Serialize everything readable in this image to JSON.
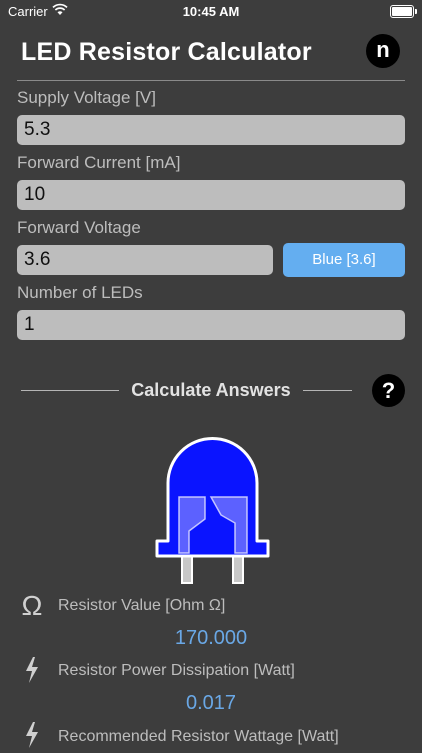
{
  "status_bar": {
    "carrier": "Carrier",
    "time": "10:45 AM"
  },
  "header": {
    "title": "LED Resistor Calculator",
    "info_button_label": "n"
  },
  "fields": {
    "supply_voltage": {
      "label": "Supply Voltage [V]",
      "value": "5.3"
    },
    "forward_current": {
      "label": "Forward Current [mA]",
      "value": "10"
    },
    "forward_voltage": {
      "label": "Forward Voltage",
      "value": "3.6"
    },
    "led_type_button": "Blue [3.6]",
    "number_of_leds": {
      "label": "Number of LEDs",
      "value": "1"
    }
  },
  "calculate": {
    "label": "Calculate Answers",
    "help_label": "?"
  },
  "led": {
    "color": "#0a14ff",
    "outline": "#ffffff"
  },
  "results": {
    "resistor_value": {
      "icon": "omega-icon",
      "symbol": "Ω",
      "label": "Resistor Value [Ohm Ω]",
      "value": "170.000"
    },
    "power_dissipation": {
      "icon": "lightning-icon",
      "label": "Resistor Power Dissipation [Watt]",
      "value": "0.017"
    },
    "recommended_wattage": {
      "icon": "lightning-icon",
      "label": "Recommended Resistor Wattage [Watt]"
    }
  },
  "colors": {
    "background": "#3d3d3d",
    "accent": "#64aef0",
    "result_value": "#6aa8e6"
  }
}
